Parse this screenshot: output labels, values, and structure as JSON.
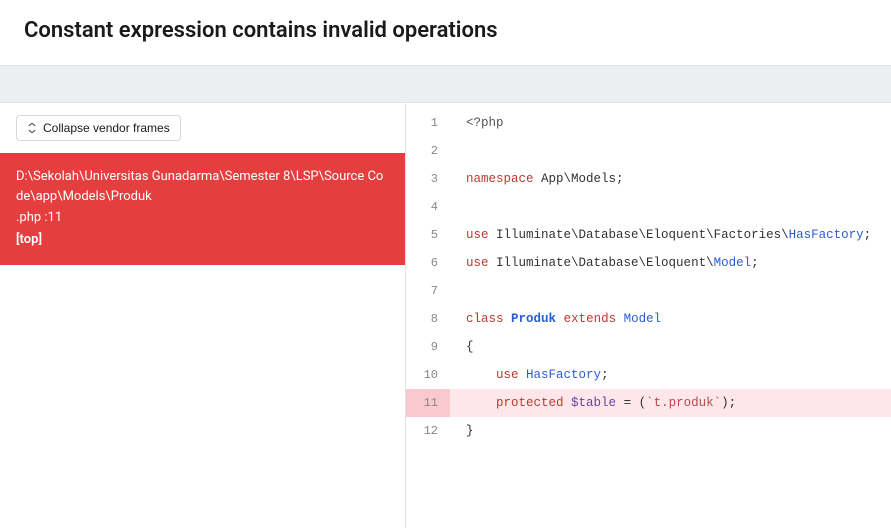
{
  "error": {
    "title": "Constant expression contains invalid operations"
  },
  "sidebar": {
    "collapse_label": "Collapse vendor frames",
    "active_frame": {
      "path": "D:\\Sekolah\\Universitas Gunadarma\\Semester 8\\LSP\\Source Code\\app\\Models\\Produk",
      "ext_line": ".php :11",
      "scope": "[top]"
    }
  },
  "code": {
    "highlight_line": 11,
    "lines": [
      {
        "n": 1,
        "html": "<span class='t-meta'>&lt;?php</span>"
      },
      {
        "n": 2,
        "html": ""
      },
      {
        "n": 3,
        "html": "<span class='t-kw'>namespace</span> <span class='t-ns'>App\\Models</span><span class='t-punct'>;</span>"
      },
      {
        "n": 4,
        "html": ""
      },
      {
        "n": 5,
        "html": "<span class='t-kw'>use</span> <span class='t-ns'>Illuminate\\Database\\Eloquent\\Factories\\</span><span class='t-kw2'>HasFactory</span><span class='t-punct'>;</span>"
      },
      {
        "n": 6,
        "html": "<span class='t-kw'>use</span> <span class='t-ns'>Illuminate\\Database\\Eloquent\\</span><span class='t-kw2'>Model</span><span class='t-punct'>;</span>"
      },
      {
        "n": 7,
        "html": ""
      },
      {
        "n": 8,
        "html": "<span class='t-kw'>class</span> <span class='t-cls'>Produk</span> <span class='t-kw'>extends</span> <span class='t-kw2'>Model</span>"
      },
      {
        "n": 9,
        "html": "<span class='t-punct'>{</span>"
      },
      {
        "n": 10,
        "html": "    <span class='t-kw'>use</span> <span class='t-kw2'>HasFactory</span><span class='t-punct'>;</span>"
      },
      {
        "n": 11,
        "html": "    <span class='t-kw'>protected</span> <span class='t-var'>$table</span> <span class='t-punct'>=</span> <span class='t-punct'>(</span><span class='t-str'>`t.produk`</span><span class='t-punct'>);</span>"
      },
      {
        "n": 12,
        "html": "<span class='t-punct'>}</span>"
      }
    ]
  }
}
